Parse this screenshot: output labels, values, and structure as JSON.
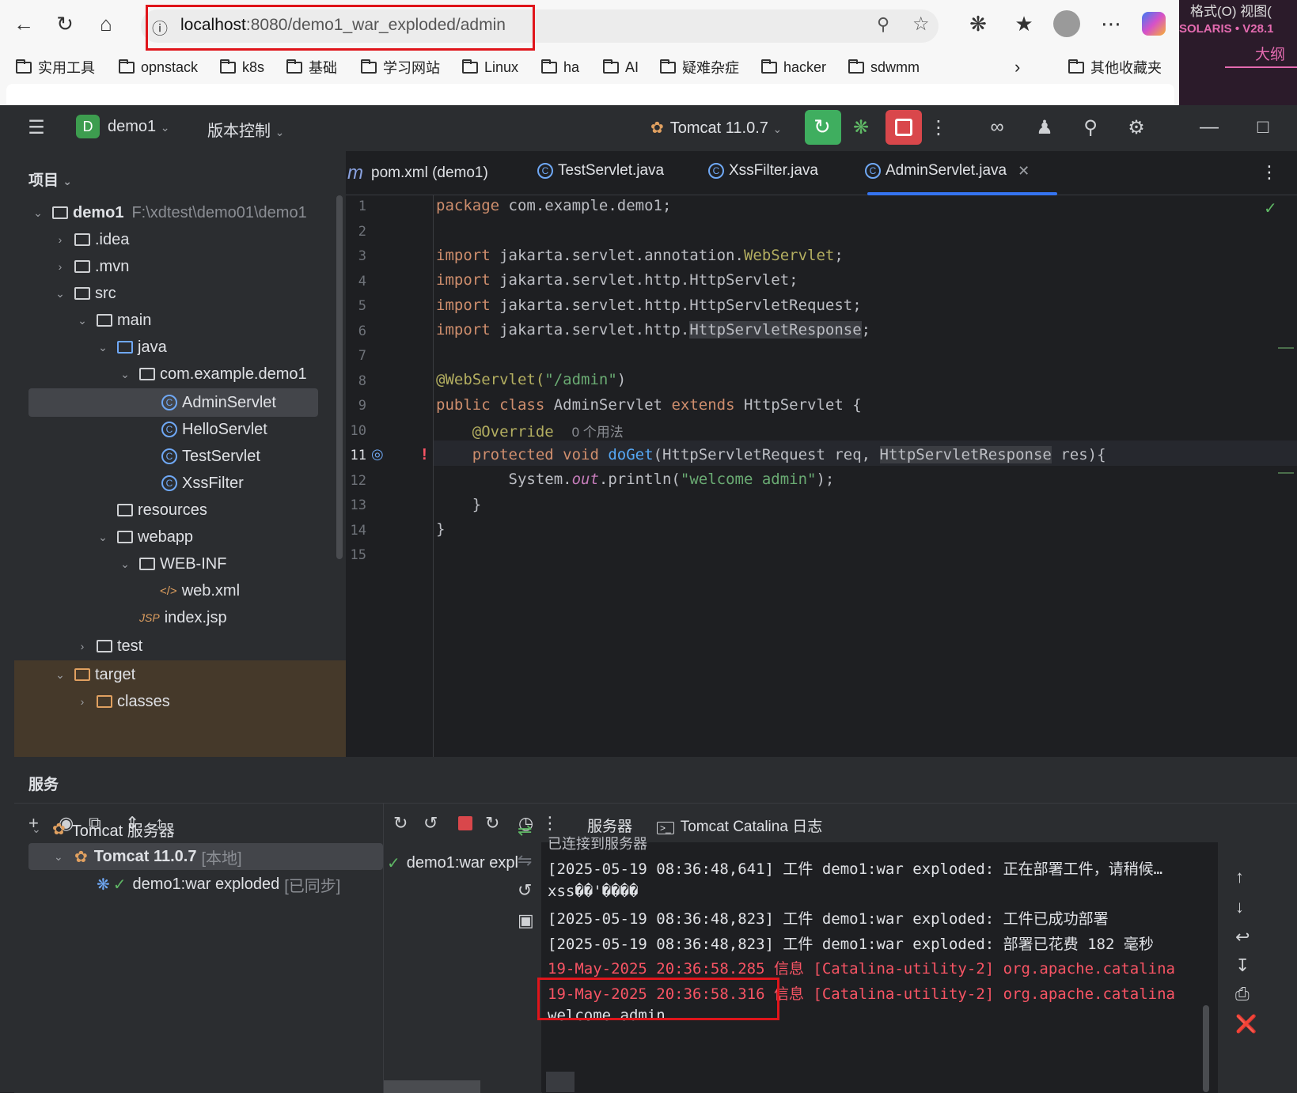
{
  "browser": {
    "url_host": "localhost",
    "url_path": ":8080/demo1_war_exploded/admin",
    "bookmarks": [
      "实用工具",
      "opnstack",
      "k8s",
      "基础",
      "学习网站",
      "Linux",
      "ha",
      "AI",
      "疑难杂症",
      "hacker",
      "sdwmm"
    ],
    "other_bookmarks": "其他收藏夹"
  },
  "side_window": {
    "menu": "格式(O)  视图(",
    "brand": "SOLARIS • V28.1",
    "outline": "大纲"
  },
  "ide": {
    "project_badge": "D",
    "project_name": "demo1",
    "vcs_label": "版本控制",
    "run_config": "Tomcat 11.0.7"
  },
  "project_panel": {
    "title": "项目",
    "tree": [
      {
        "label": "demo1",
        "path": "F:\\xdtest\\demo01\\demo1"
      },
      {
        "label": ".idea"
      },
      {
        "label": ".mvn"
      },
      {
        "label": "src"
      },
      {
        "label": "main"
      },
      {
        "label": "java"
      },
      {
        "label": "com.example.demo1"
      },
      {
        "label": "AdminServlet"
      },
      {
        "label": "HelloServlet"
      },
      {
        "label": "TestServlet"
      },
      {
        "label": "XssFilter"
      },
      {
        "label": "resources"
      },
      {
        "label": "webapp"
      },
      {
        "label": "WEB-INF"
      },
      {
        "label": "web.xml"
      },
      {
        "label": "index.jsp"
      },
      {
        "label": "test"
      },
      {
        "label": "target"
      },
      {
        "label": "classes"
      }
    ]
  },
  "editor": {
    "tabs": [
      "pom.xml (demo1)",
      "TestServlet.java",
      "XssFilter.java",
      "AdminServlet.java"
    ],
    "active_tab": "AdminServlet.java",
    "line_numbers": [
      "1",
      "2",
      "3",
      "4",
      "5",
      "6",
      "7",
      "8",
      "9",
      "10",
      "11",
      "12",
      "13",
      "14",
      "15"
    ],
    "code": {
      "l1_kw": "package",
      "l1_rest": " com.example.demo1;",
      "import_kw": "import",
      "l3_a": " jakarta.servlet.annotation.",
      "l3_b": "WebServlet",
      "l3_c": ";",
      "l4": " jakarta.servlet.http.HttpServlet;",
      "l5": " jakarta.servlet.http.HttpServletRequest;",
      "l6_a": " jakarta.servlet.http.",
      "l6_b": "HttpServletResponse",
      "l6_c": ";",
      "l8_a": "@WebServlet(",
      "l8_b": "\"/admin\"",
      "l8_c": ")",
      "l9_a": "public class",
      "l9_b": " AdminServlet ",
      "l9_c": "extends",
      "l9_d": " HttpServlet {",
      "l10_a": "    @Override",
      "l10_hint": "0 个用法",
      "l11_a": "    protected void ",
      "l11_b": "doGet",
      "l11_c": "(HttpServletRequest req, ",
      "l11_d": "HttpServletResponse",
      "l11_e": " res){",
      "l12_a": "        System.",
      "l12_b": "out",
      "l12_c": ".println(",
      "l12_d": "\"welcome admin\"",
      "l12_e": ");",
      "l13": "    }",
      "l14": "}"
    }
  },
  "services": {
    "title": "服务",
    "tree": [
      {
        "label": "Tomcat 服务器"
      },
      {
        "label": "Tomcat 11.0.7",
        "note": "[本地]"
      },
      {
        "label": "demo1:war exploded",
        "note": "[已同步]"
      }
    ],
    "deployment": "demo1:war expl",
    "console_tabs": [
      "服务器",
      "Tomcat Catalina 日志"
    ],
    "console_lines": [
      {
        "text": "已连接到服务器",
        "color": "normal"
      },
      {
        "text": "[2025-05-19 08:36:48,641] 工件 demo1:war exploded: 正在部署工件，请稍候…",
        "color": "normal"
      },
      {
        "text": "xss��'����",
        "color": "normal"
      },
      {
        "text": "[2025-05-19 08:36:48,823] 工件 demo1:war exploded: 工件已成功部署",
        "color": "normal"
      },
      {
        "text": "[2025-05-19 08:36:48,823] 工件 demo1:war exploded: 部署已花费 182 毫秒",
        "color": "normal"
      },
      {
        "text": "19-May-2025 20:36:58.285 信息 [Catalina-utility-2] org.apache.catalina",
        "color": "red"
      },
      {
        "text": "19-May-2025 20:36:58.316 信息 [Catalina-utility-2] org.apache.catalina",
        "color": "red"
      },
      {
        "text": "welcome admin",
        "color": "normal"
      }
    ]
  },
  "colors": {
    "accent": "#3574f0",
    "run": "#3fae5f",
    "stop": "#d9474b",
    "highlight_box": "#e0151b"
  }
}
